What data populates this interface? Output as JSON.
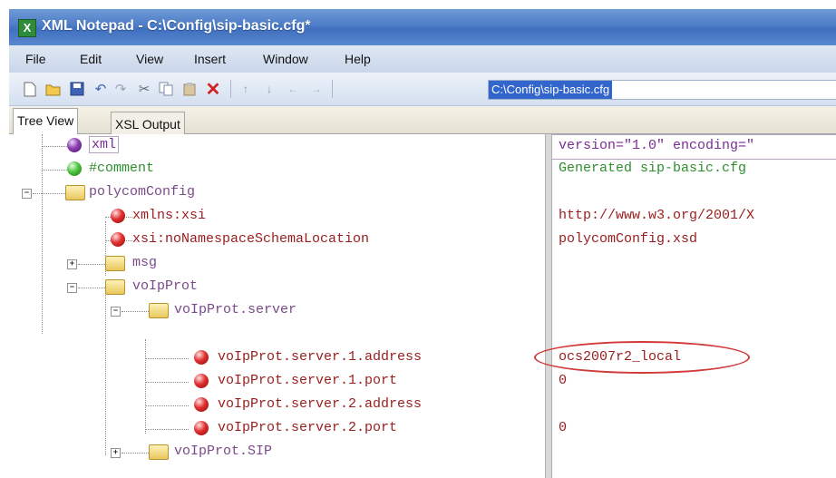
{
  "window": {
    "title": "XML Notepad - C:\\Config\\sip-basic.cfg*",
    "app_icon": "X"
  },
  "menu": [
    "File",
    "Edit",
    "View",
    "Insert",
    "Window",
    "Help"
  ],
  "toolbar": {
    "icons": [
      "new-file-icon",
      "open-folder-icon",
      "save-icon",
      "undo-icon",
      "redo-icon",
      "cut-icon",
      "copy-icon",
      "paste-icon",
      "delete-icon",
      "nudge-up-icon",
      "nudge-down-icon",
      "nudge-left-icon",
      "nudge-right-icon"
    ],
    "path_value": "C:\\Config\\sip-basic.cfg"
  },
  "tabs": [
    {
      "label": "Tree View",
      "active": true
    },
    {
      "label": "XSL Output",
      "active": false
    }
  ],
  "tree": [
    {
      "label": "xml",
      "type": "pi",
      "icon": "purple-ball-icon"
    },
    {
      "label": "#comment",
      "type": "comment",
      "icon": "green-ball-icon"
    },
    {
      "label": "polycomConfig",
      "type": "element",
      "icon": "folder-icon",
      "expanded": true
    },
    {
      "label": "xmlns:xsi",
      "type": "attribute",
      "icon": "red-ball-icon"
    },
    {
      "label": "xsi:noNamespaceSchemaLocation",
      "type": "attribute",
      "icon": "red-ball-icon"
    },
    {
      "label": "msg",
      "type": "element",
      "icon": "folder-icon",
      "expanded": false
    },
    {
      "label": "voIpProt",
      "type": "element",
      "icon": "folder-icon",
      "expanded": true
    },
    {
      "label": "voIpProt.server",
      "type": "element",
      "icon": "folder-icon",
      "expanded": true
    },
    {
      "label": "voIpProt.server.1.address",
      "type": "attribute",
      "icon": "red-ball-icon"
    },
    {
      "label": "voIpProt.server.1.port",
      "type": "attribute",
      "icon": "red-ball-icon"
    },
    {
      "label": "voIpProt.server.2.address",
      "type": "attribute",
      "icon": "red-ball-icon"
    },
    {
      "label": "voIpProt.server.2.port",
      "type": "attribute",
      "icon": "red-ball-icon"
    },
    {
      "label": "voIpProt.SIP",
      "type": "element",
      "icon": "folder-icon",
      "expanded": false
    }
  ],
  "values": [
    "version=\"1.0\" encoding=\"",
    "Generated sip-basic.cfg",
    "",
    "http://www.w3.org/2001/X",
    "polycomConfig.xsd",
    "",
    "",
    "",
    "ocs2007r2_local",
    "0",
    "",
    "0",
    ""
  ],
  "colors": {
    "title_bar": "#4d7cc7",
    "selection": "#3366cc",
    "annotation": "#d23a3a"
  }
}
